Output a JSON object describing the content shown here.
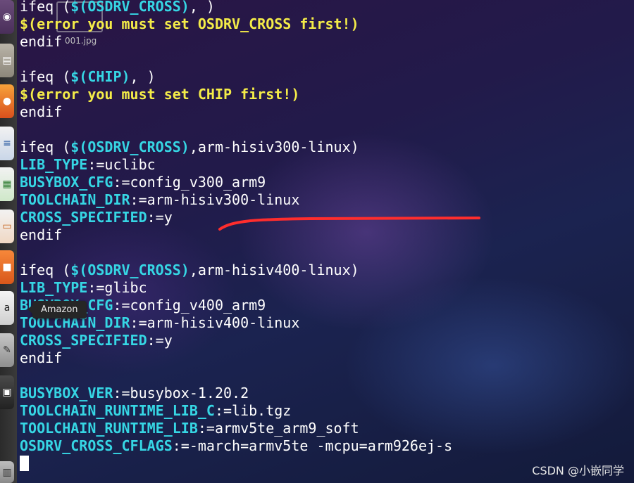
{
  "launcher": {
    "items": [
      {
        "name": "dash-home",
        "glyph": "◉"
      },
      {
        "name": "files",
        "glyph": "▤"
      },
      {
        "name": "firefox",
        "glyph": "●"
      },
      {
        "name": "libreoffice-writer",
        "glyph": "≡"
      },
      {
        "name": "libreoffice-calc",
        "glyph": "▦"
      },
      {
        "name": "libreoffice-impress",
        "glyph": "▭"
      },
      {
        "name": "ubuntu-software",
        "glyph": "■"
      },
      {
        "name": "amazon",
        "glyph": "a"
      },
      {
        "name": "system-settings",
        "glyph": "✎"
      },
      {
        "name": "terminal",
        "glyph": "▣"
      },
      {
        "name": "trash",
        "glyph": "▥"
      }
    ],
    "tooltip": "Amazon"
  },
  "overlay": {
    "file_label": "001.jpg"
  },
  "terminal": {
    "lines": [
      [
        {
          "t": "kw",
          "s": "ifeq ("
        },
        {
          "t": "var",
          "s": "$(OSDRV_CROSS)"
        },
        {
          "t": "txt",
          "s": ", )"
        }
      ],
      [
        {
          "t": "err",
          "s": "$(error you must set OSDRV_CROSS first!)"
        }
      ],
      [
        {
          "t": "kw",
          "s": "endif"
        }
      ],
      [],
      [
        {
          "t": "kw",
          "s": "ifeq ("
        },
        {
          "t": "var",
          "s": "$(CHIP)"
        },
        {
          "t": "txt",
          "s": ", )"
        }
      ],
      [
        {
          "t": "err",
          "s": "$(error you must set CHIP first!)"
        }
      ],
      [
        {
          "t": "kw",
          "s": "endif"
        }
      ],
      [],
      [
        {
          "t": "kw",
          "s": "ifeq ("
        },
        {
          "t": "var",
          "s": "$(OSDRV_CROSS)"
        },
        {
          "t": "txt",
          "s": ",arm-hisiv300-linux)"
        }
      ],
      [
        {
          "t": "var",
          "s": "LIB_TYPE"
        },
        {
          "t": "txt",
          "s": ":=uclibc"
        }
      ],
      [
        {
          "t": "var",
          "s": "BUSYBOX_CFG"
        },
        {
          "t": "txt",
          "s": ":=config_v300_arm9"
        }
      ],
      [
        {
          "t": "var",
          "s": "TOOLCHAIN_DIR"
        },
        {
          "t": "txt",
          "s": ":=arm-hisiv300-linux"
        }
      ],
      [
        {
          "t": "var",
          "s": "CROSS_SPECIFIED"
        },
        {
          "t": "txt",
          "s": ":=y"
        }
      ],
      [
        {
          "t": "kw",
          "s": "endif"
        }
      ],
      [],
      [
        {
          "t": "kw",
          "s": "ifeq ("
        },
        {
          "t": "var",
          "s": "$(OSDRV_CROSS)"
        },
        {
          "t": "txt",
          "s": ",arm-hisiv400-linux)"
        }
      ],
      [
        {
          "t": "var",
          "s": "LIB_TYPE"
        },
        {
          "t": "txt",
          "s": ":=glibc"
        }
      ],
      [
        {
          "t": "var",
          "s": "BUSYBOX_CFG"
        },
        {
          "t": "txt",
          "s": ":=config_v400_arm9"
        }
      ],
      [
        {
          "t": "var",
          "s": "TOOLCHAIN_DIR"
        },
        {
          "t": "txt",
          "s": ":=arm-hisiv400-linux"
        }
      ],
      [
        {
          "t": "var",
          "s": "CROSS_SPECIFIED"
        },
        {
          "t": "txt",
          "s": ":=y"
        }
      ],
      [
        {
          "t": "kw",
          "s": "endif"
        }
      ],
      [],
      [
        {
          "t": "var",
          "s": "BUSYBOX_VER"
        },
        {
          "t": "txt",
          "s": ":=busybox-1.20.2"
        }
      ],
      [
        {
          "t": "var",
          "s": "TOOLCHAIN_RUNTIME_LIB_C"
        },
        {
          "t": "txt",
          "s": ":=lib.tgz"
        }
      ],
      [
        {
          "t": "var",
          "s": "TOOLCHAIN_RUNTIME_LIB"
        },
        {
          "t": "txt",
          "s": ":=armv5te_arm9_soft"
        }
      ],
      [
        {
          "t": "var",
          "s": "OSDRV_CROSS_CFLAGS"
        },
        {
          "t": "txt",
          "s": ":=-march=armv5te -mcpu=arm926ej-s"
        }
      ]
    ]
  },
  "colors": {
    "keyword": "#ffffff",
    "variable": "#36d6e4",
    "error": "#f4ec48",
    "annotation": "#ff2d2d"
  },
  "watermark": "CSDN @小嵌同学"
}
